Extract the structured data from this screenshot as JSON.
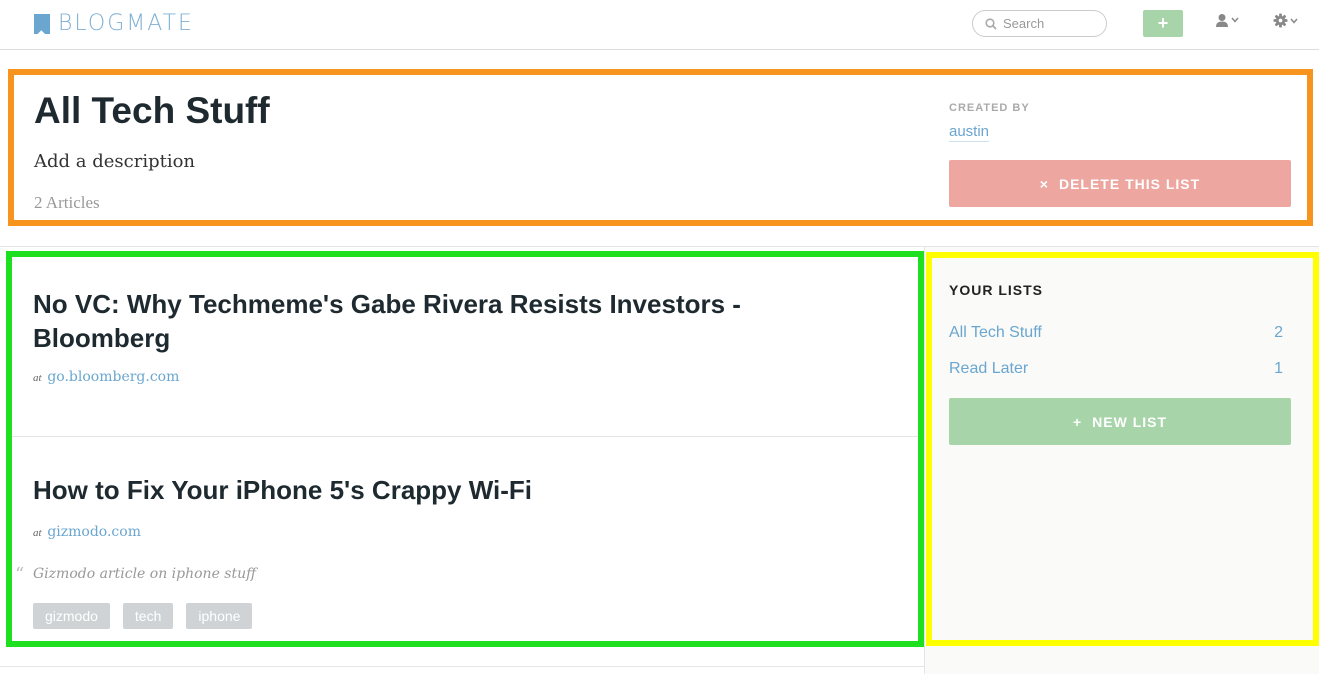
{
  "nav": {
    "brand": "BLOGMATE",
    "search_placeholder": "Search",
    "add_label": "+",
    "icons": [
      "bookmark-logo-icon",
      "search-icon",
      "user-icon",
      "gear-icon"
    ]
  },
  "list": {
    "title": "All Tech Stuff",
    "description": "Add a description",
    "count": "2 Articles",
    "created_by_label": "CREATED BY",
    "created_by_user": "austin",
    "delete_label": "DELETE THIS LIST",
    "delete_icon": "×"
  },
  "articles": [
    {
      "title": "No VC: Why Techmeme's Gabe Rivera Resists Investors - Bloomberg",
      "at": "at",
      "source": "go.bloomberg.com"
    },
    {
      "title": "How to Fix Your iPhone 5's Crappy Wi-Fi",
      "at": "at",
      "source": "gizmodo.com",
      "quote": "“",
      "note": "Gizmodo article on iphone stuff",
      "tags": [
        "gizmodo",
        "tech",
        "iphone"
      ]
    }
  ],
  "sidebar": {
    "heading": "YOUR LISTS",
    "lists": [
      {
        "name": "All Tech Stuff",
        "count": "2"
      },
      {
        "name": "Read Later",
        "count": "1"
      }
    ],
    "new_list_label": "NEW LIST",
    "new_list_icon": "+"
  },
  "colors": {
    "accent_blue": "#6aa6cf",
    "green_button": "#a8d4a9",
    "delete_button": "#eda7a0",
    "highlight_orange": "#f7941d",
    "highlight_green": "#1ee01e",
    "highlight_yellow": "#ffff00"
  }
}
